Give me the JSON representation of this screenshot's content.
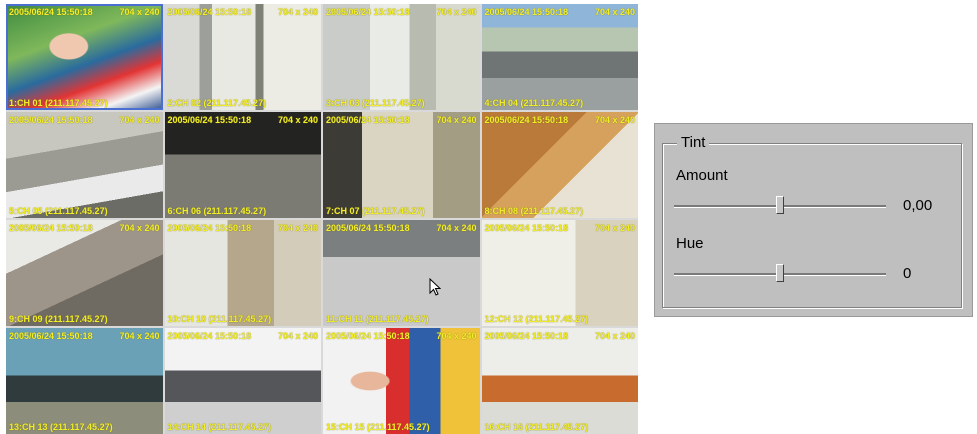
{
  "cameras": [
    {
      "timestamp": "2005/06/24 15:50:18",
      "resolution": "704 x 240",
      "label": "1:CH 01 (211.117.45.27)",
      "selected": true
    },
    {
      "timestamp": "2005/06/24 15:50:18",
      "resolution": "704 x 240",
      "label": "2:CH 02 (211.117.45.27)",
      "selected": false
    },
    {
      "timestamp": "2005/06/24 15:50:18",
      "resolution": "704 x 240",
      "label": "3:CH 03 (211.117.45.27)",
      "selected": false
    },
    {
      "timestamp": "2005/06/24 15:50:18",
      "resolution": "704 x 240",
      "label": "4:CH 04 (211.117.45.27)",
      "selected": false
    },
    {
      "timestamp": "2005/06/24 15:50:18",
      "resolution": "704 x 240",
      "label": "5:CH 05 (211.117.45.27)",
      "selected": false
    },
    {
      "timestamp": "2005/06/24 15:50:18",
      "resolution": "704 x 240",
      "label": "6:CH 06 (211.117.45.27)",
      "selected": false
    },
    {
      "timestamp": "2005/06/24 15:50:18",
      "resolution": "704 x 240",
      "label": "7:CH 07 (211.117.45.27)",
      "selected": false
    },
    {
      "timestamp": "2005/06/24 15:50:18",
      "resolution": "704 x 240",
      "label": "8:CH 08 (211.117.45.27)",
      "selected": false
    },
    {
      "timestamp": "2005/06/24 15:50:18",
      "resolution": "704 x 240",
      "label": "9:CH 09 (211.117.45.27)",
      "selected": false
    },
    {
      "timestamp": "2005/06/24 15:50:18",
      "resolution": "704 x 240",
      "label": "10:CH 10 (211.117.45.27)",
      "selected": false
    },
    {
      "timestamp": "2005/06/24 15:50:18",
      "resolution": "704 x 240",
      "label": "11:CH 11 (211.117.45.27)",
      "selected": false
    },
    {
      "timestamp": "2005/06/24 15:50:18",
      "resolution": "704 x 240",
      "label": "12:CH 12 (211.117.45.27)",
      "selected": false
    },
    {
      "timestamp": "2005/06/24 15:50:18",
      "resolution": "704 x 240",
      "label": "13:CH 13 (211.117.45.27)",
      "selected": false
    },
    {
      "timestamp": "2005/06/24 15:50:18",
      "resolution": "704 x 240",
      "label": "14:CH 14 (211.117.45.27)",
      "selected": false
    },
    {
      "timestamp": "2005/06/24 15:50:18",
      "resolution": "704 x 240",
      "label": "15:CH 15 (211.117.45.27)",
      "selected": false
    },
    {
      "timestamp": "2005/06/24 15:50:18",
      "resolution": "704 x 240",
      "label": "16:CH 16 (211.117.45.27)",
      "selected": false
    }
  ],
  "tint": {
    "title": "Tint",
    "amount": {
      "label": "Amount",
      "value_text": "0,00",
      "level": 0.5
    },
    "hue": {
      "label": "Hue",
      "value_text": "0",
      "level": 0.5
    }
  },
  "colors": {
    "overlay_text": "#f2ee2a",
    "panel_bg": "#bfbfbf",
    "selection": "#4a6fd0"
  },
  "icons": {
    "mouse_cursor": "arrow-cursor-icon"
  }
}
